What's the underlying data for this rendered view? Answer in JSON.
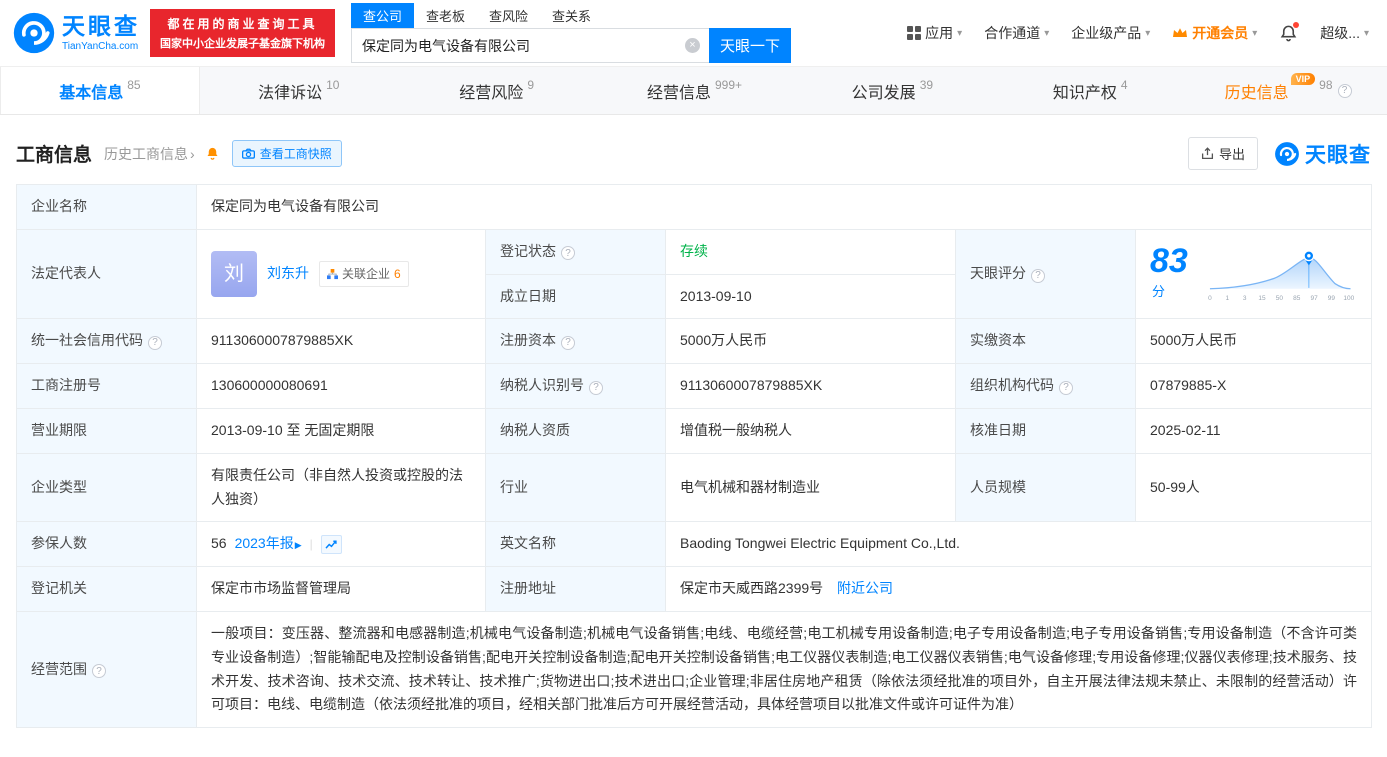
{
  "colors": {
    "brand_blue": "#0084ff",
    "vip_orange": "#ff8000",
    "status_green": "#00b34a",
    "promo_red": "#e8262d",
    "label_bg": "#f2f9ff"
  },
  "icons": {
    "caret_down": "▾",
    "chevron_right": "›",
    "clear": "×",
    "question": "?",
    "play": "▶",
    "divider": "|"
  },
  "header": {
    "brand_cn": "天眼查",
    "brand_en": "TianYanCha.com",
    "promo_line1": "都在用的商业查询工具",
    "promo_line2": "国家中小企业发展子基金旗下机构",
    "search_tabs": [
      {
        "label": "查公司"
      },
      {
        "label": "查老板"
      },
      {
        "label": "查风险"
      },
      {
        "label": "查关系"
      }
    ],
    "search": {
      "value": "保定同为电气设备有限公司",
      "button": "天眼一下"
    },
    "nav": [
      {
        "label": "应用"
      },
      {
        "label": "合作通道"
      },
      {
        "label": "企业级产品"
      },
      {
        "label": "开通会员"
      },
      {
        "label": "超级..."
      }
    ]
  },
  "tabs": [
    {
      "label": "基本信息",
      "count": "85"
    },
    {
      "label": "法律诉讼",
      "count": "10"
    },
    {
      "label": "经营风险",
      "count": "9"
    },
    {
      "label": "经营信息",
      "count": "999+"
    },
    {
      "label": "公司发展",
      "count": "39"
    },
    {
      "label": "知识产权",
      "count": "4"
    },
    {
      "label": "历史信息",
      "count": "98",
      "vip": "VIP"
    }
  ],
  "section": {
    "title": "工商信息",
    "history_link": "历史工商信息",
    "snapshot_button": "查看工商快照",
    "export_button": "导出",
    "watermark": "天眼查"
  },
  "fields": {
    "company_name": {
      "label": "企业名称",
      "value": "保定同为电气设备有限公司"
    },
    "legal_rep": {
      "label": "法定代表人",
      "avatar": "刘",
      "name": "刘东升",
      "related_label": "关联企业",
      "related_count": "6"
    },
    "reg_status": {
      "label": "登记状态",
      "value": "存续"
    },
    "establish_date": {
      "label": "成立日期",
      "value": "2013-09-10"
    },
    "score": {
      "label": "天眼评分",
      "value": "83",
      "unit": "分",
      "axis": [
        "0",
        "1",
        "3",
        "15",
        "50",
        "85",
        "97",
        "99",
        "100"
      ]
    },
    "credit_code": {
      "label": "统一社会信用代码",
      "value": "9113060007879885XK"
    },
    "reg_capital": {
      "label": "注册资本",
      "value": "5000万人民币"
    },
    "paid_capital": {
      "label": "实缴资本",
      "value": "5000万人民币"
    },
    "reg_number": {
      "label": "工商注册号",
      "value": "130600000080691"
    },
    "taxpayer_id": {
      "label": "纳税人识别号",
      "value": "9113060007879885XK"
    },
    "org_code": {
      "label": "组织机构代码",
      "value": "07879885-X"
    },
    "business_term": {
      "label": "营业期限",
      "value": "2013-09-10 至 无固定期限"
    },
    "taxpayer_quality": {
      "label": "纳税人资质",
      "value": "增值税一般纳税人"
    },
    "approval_date": {
      "label": "核准日期",
      "value": "2025-02-11"
    },
    "company_type": {
      "label": "企业类型",
      "value": "有限责任公司（非自然人投资或控股的法人独资）"
    },
    "industry": {
      "label": "行业",
      "value": "电气机械和器材制造业"
    },
    "staff_size": {
      "label": "人员规模",
      "value": "50-99人"
    },
    "insured": {
      "label": "参保人数",
      "value": "56",
      "report_link": "2023年报"
    },
    "english_name": {
      "label": "英文名称",
      "value": "Baoding Tongwei Electric Equipment Co.,Ltd."
    },
    "reg_authority": {
      "label": "登记机关",
      "value": "保定市市场监督管理局"
    },
    "reg_address": {
      "label": "注册地址",
      "value": "保定市天威西路2399号",
      "nearby_link": "附近公司"
    },
    "business_scope": {
      "label": "经营范围",
      "value": "一般项目：变压器、整流器和电感器制造;机械电气设备制造;机械电气设备销售;电线、电缆经营;电工机械专用设备制造;电子专用设备制造;电子专用设备销售;专用设备制造（不含许可类专业设备制造）;智能输配电及控制设备销售;配电开关控制设备制造;配电开关控制设备销售;电工仪器仪表制造;电工仪器仪表销售;电气设备修理;专用设备修理;仪器仪表修理;技术服务、技术开发、技术咨询、技术交流、技术转让、技术推广;货物进出口;技术进出口;企业管理;非居住房地产租赁（除依法须经批准的项目外，自主开展法律法规未禁止、未限制的经营活动）许可项目：电线、电缆制造（依法须经批准的项目，经相关部门批准后方可开展经营活动，具体经营项目以批准文件或许可证件为准）"
    }
  }
}
